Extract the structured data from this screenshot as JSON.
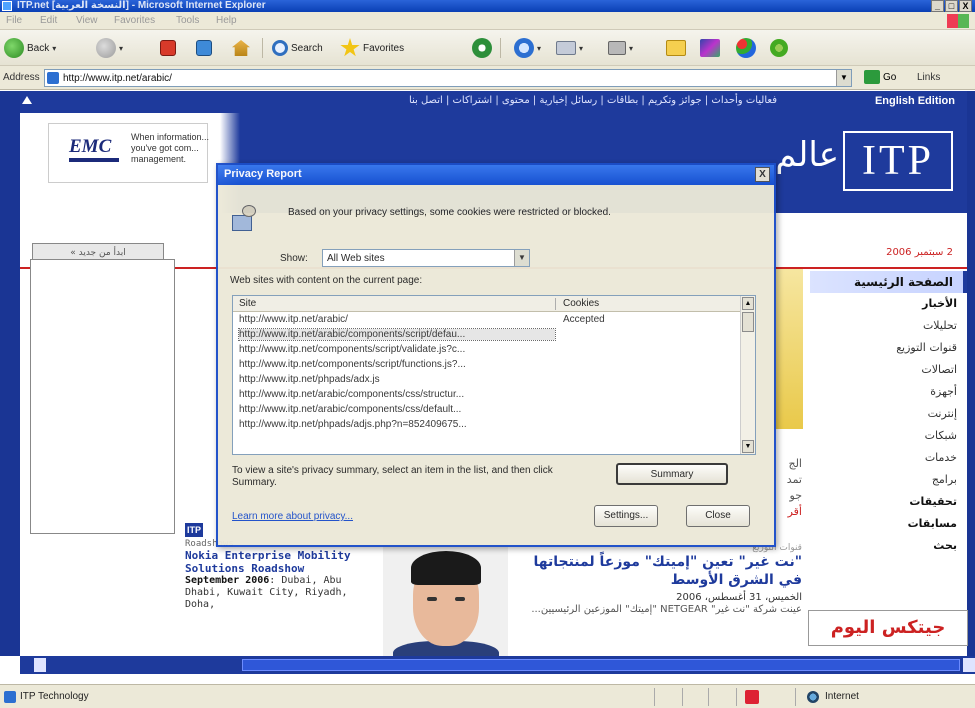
{
  "window": {
    "title": "ITP.net [النسخة العربية] - Microsoft Internet Explorer",
    "controls": [
      "_",
      "□",
      "X"
    ]
  },
  "menu": [
    "File",
    "Edit",
    "View",
    "Favorites",
    "Tools",
    "Help"
  ],
  "toolbar": {
    "back": "Back",
    "search": "Search",
    "favorites": "Favorites"
  },
  "address": {
    "label": "Address",
    "url": "http://www.itp.net/arabic/",
    "go": "Go",
    "links": "Links"
  },
  "page": {
    "nav_links": "فعاليات وأحداث | جوائز وتكريم | بطاقات | رسائل إخبارية | محتوى | اشتراكات | اتصل بنا",
    "english_edition": "English Edition",
    "emc_logo": "EMC",
    "emc_text": "When information... you've got com... management.",
    "itp_logo": "ITP",
    "itp_arabic": "عالم",
    "search_button": "ابدأ من جديد »",
    "date": "2 سبتمبر 2006",
    "side_header": "الصفحة الرئيسية",
    "side_items": [
      {
        "label": "الأخبار",
        "bold": true
      },
      {
        "label": "تحليلات",
        "bold": false
      },
      {
        "label": "قنوات التوزيع",
        "bold": false
      },
      {
        "label": "اتصالات",
        "bold": false
      },
      {
        "label": "أجهزة",
        "bold": false
      },
      {
        "label": "إنترنت",
        "bold": false
      },
      {
        "label": "شبكات",
        "bold": false
      },
      {
        "label": "خدمات",
        "bold": false
      },
      {
        "label": "برامج",
        "bold": false
      },
      {
        "label": "تحقيقات",
        "bold": true
      },
      {
        "label": "مسابقات",
        "bold": true
      },
      {
        "label": "بحث",
        "bold": true
      }
    ],
    "gitex": "جيتكس اليوم",
    "left_news": {
      "tag": "ITP",
      "kicker": "Roadshows",
      "title": "Nokia Enterprise Mobility Solutions Roadshow",
      "date": "September 2006",
      "body": ": Dubai, Abu Dhabi, Kuwait City, Riyadh, Doha,"
    },
    "right_news": {
      "category": "قنوات التوزيع",
      "headline": "\"نت غير\" تعين \"إميتك\" موزعاً لمنتجاتها في الشرق الأوسط",
      "date": "الخميس، 31 أغسطس، 2006",
      "body": "عينت شركة \"نت غير\" NETGEAR \"إميتك\" الموزعين الرئيسيين..."
    },
    "mid_text": [
      "الج",
      "تمد",
      "جو",
      "أقر"
    ]
  },
  "dialog": {
    "title": "Privacy Report",
    "close": "X",
    "message": "Based on your privacy settings, some cookies were restricted or blocked.",
    "show_label": "Show:",
    "show_value": "All Web sites",
    "list_label": "Web sites with content on the current page:",
    "columns": [
      "Site",
      "Cookies"
    ],
    "rows": [
      {
        "site": "http://www.itp.net/arabic/",
        "cookies": "Accepted",
        "selected": false
      },
      {
        "site": "http://www.itp.net/arabic/components/script/defau...",
        "cookies": "",
        "selected": true
      },
      {
        "site": "http://www.itp.net/components/script/validate.js?c...",
        "cookies": "",
        "selected": false
      },
      {
        "site": "http://www.itp.net/components/script/functions.js?...",
        "cookies": "",
        "selected": false
      },
      {
        "site": "http://www.itp.net/phpads/adx.js",
        "cookies": "",
        "selected": false
      },
      {
        "site": "http://www.itp.net/arabic/components/css/structur...",
        "cookies": "",
        "selected": false
      },
      {
        "site": "http://www.itp.net/arabic/components/css/default...",
        "cookies": "",
        "selected": false
      },
      {
        "site": "http://www.itp.net/phpads/adjs.php?n=852409675...",
        "cookies": "",
        "selected": false
      }
    ],
    "hint": "To view a site's privacy summary, select an item in the list, and then click Summary.",
    "summary": "Summary",
    "learn_more": "Learn more about privacy...",
    "settings": "Settings...",
    "close_button": "Close"
  },
  "status": {
    "text": "ITP Technology",
    "zone": "Internet"
  }
}
